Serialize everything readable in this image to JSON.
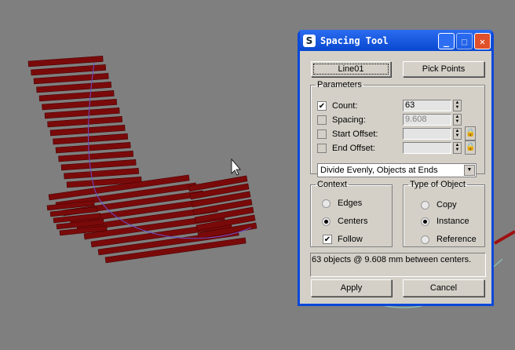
{
  "window": {
    "title": "Spacing Tool",
    "minimize": "_",
    "maximize": "□",
    "close": "✕"
  },
  "buttons": {
    "path": "Line01",
    "pick_points": "Pick Points",
    "apply": "Apply",
    "cancel": "Cancel"
  },
  "parameters": {
    "label": "Parameters",
    "count": {
      "label": "Count:",
      "checked": true,
      "value": "63"
    },
    "spacing": {
      "label": "Spacing:",
      "checked": false,
      "value": "9.608"
    },
    "start_offset": {
      "label": "Start Offset:",
      "checked": false,
      "value": ""
    },
    "end_offset": {
      "label": "End Offset:",
      "checked": false,
      "value": ""
    },
    "mode": "Divide Evenly, Objects at Ends"
  },
  "context": {
    "label": "Context",
    "edges": "Edges",
    "centers": "Centers",
    "follow": "Follow",
    "selected": "Centers",
    "follow_checked": true
  },
  "type_of_object": {
    "label": "Type of Object",
    "copy": "Copy",
    "instance": "Instance",
    "reference": "Reference",
    "selected": "Instance"
  },
  "status": "63 objects @ 9.608 mm between centers.",
  "colors": {
    "viewport": "#7f7f7f",
    "slat": "#7a0a0a",
    "titlebar": "#0a48d8"
  }
}
